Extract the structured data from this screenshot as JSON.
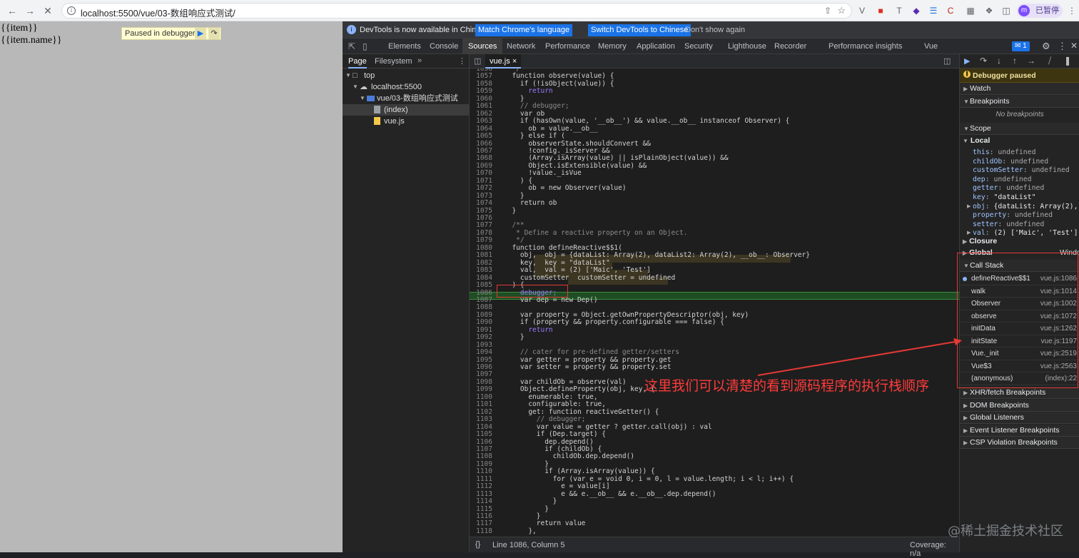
{
  "browser": {
    "url": "localhost:5500/vue/03-数组响应式测试/",
    "profile_initial": "m",
    "profile_label": "已暂停"
  },
  "page": {
    "template_lines": [
      "{{item}}",
      "{{item.name}}"
    ],
    "paused_label": "Paused in debugger"
  },
  "devtools": {
    "infobar": {
      "message": "DevTools is now available in Chinese!",
      "match_button": "Match Chrome's language",
      "switch_button": "Switch DevTools to Chinese",
      "dismiss": "Don't show again"
    },
    "tabs": [
      "Elements",
      "Console",
      "Sources",
      "Network",
      "Performance",
      "Memory",
      "Application",
      "Security",
      "Lighthouse",
      "Recorder",
      "Performance insights",
      "Vue"
    ],
    "active_tab": "Sources",
    "issues_count": "1",
    "navigator": {
      "tabs": [
        "Page",
        "Filesystem"
      ],
      "tree": [
        "top",
        "localhost:5500",
        "vue/03-数组响应式测试",
        "(index)",
        "vue.js"
      ]
    },
    "editor": {
      "file_tab": "vue.js",
      "status_left": "Line 1086, Column 5",
      "status_right": "Coverage: n/a",
      "status_braces": "{}"
    },
    "sidebar": {
      "paused": "Debugger paused",
      "watch": "Watch",
      "breakpoints": "Breakpoints",
      "no_breakpoints": "No breakpoints",
      "scope": "Scope",
      "local": "Local",
      "scope_vars": [
        {
          "k": "this",
          "v": "undefined"
        },
        {
          "k": "childOb",
          "v": "undefined"
        },
        {
          "k": "customSetter",
          "v": "undefined"
        },
        {
          "k": "dep",
          "v": "undefined"
        },
        {
          "k": "getter",
          "v": "undefined"
        },
        {
          "k": "key",
          "v": "\"dataList\""
        },
        {
          "k": "obj",
          "v": "{dataList: Array(2),"
        },
        {
          "k": "property",
          "v": "undefined"
        },
        {
          "k": "setter",
          "v": "undefined"
        },
        {
          "k": "val",
          "v": "(2) ['Maic', 'Test']"
        }
      ],
      "closure": "Closure",
      "global": "Global",
      "global_value": "Windo",
      "call_stack": "Call Stack",
      "frames": [
        {
          "fn": "defineReactive$$1",
          "loc": "vue.js:1086"
        },
        {
          "fn": "walk",
          "loc": "vue.js:1014"
        },
        {
          "fn": "Observer",
          "loc": "vue.js:1002"
        },
        {
          "fn": "observe",
          "loc": "vue.js:1072"
        },
        {
          "fn": "initData",
          "loc": "vue.js:1262"
        },
        {
          "fn": "initState",
          "loc": "vue.js:1197"
        },
        {
          "fn": "Vue._init",
          "loc": "vue.js:2519"
        },
        {
          "fn": "Vue$3",
          "loc": "vue.js:2563"
        },
        {
          "fn": "(anonymous)",
          "loc": "(index):22"
        }
      ],
      "more_sections": [
        "XHR/fetch Breakpoints",
        "DOM Breakpoints",
        "Global Listeners",
        "Event Listener Breakpoints",
        "CSP Violation Breakpoints"
      ]
    }
  },
  "code": [
    {
      "n": "1056",
      "t": "  */",
      "c": "cm"
    },
    {
      "n": "1057",
      "t": "  function observe(value) {",
      "c": ""
    },
    {
      "n": "1058",
      "t": "    if (!isObject(value)) {",
      "c": ""
    },
    {
      "n": "1059",
      "t": "      return",
      "c": "kw"
    },
    {
      "n": "1060",
      "t": "    }",
      "c": ""
    },
    {
      "n": "1061",
      "t": "    // debugger;",
      "c": "cm"
    },
    {
      "n": "1062",
      "t": "    var ob",
      "c": ""
    },
    {
      "n": "1063",
      "t": "    if (hasOwn(value, '__ob__') && value.__ob__ instanceof Observer) {",
      "c": ""
    },
    {
      "n": "1064",
      "t": "      ob = value.__ob__",
      "c": ""
    },
    {
      "n": "1065",
      "t": "    } else if (",
      "c": ""
    },
    {
      "n": "1066",
      "t": "      observerState.shouldConvert &&",
      "c": ""
    },
    {
      "n": "1067",
      "t": "      !config._isServer &&",
      "c": ""
    },
    {
      "n": "1068",
      "t": "      (Array.isArray(value) || isPlainObject(value)) &&",
      "c": ""
    },
    {
      "n": "1069",
      "t": "      Object.isExtensible(value) &&",
      "c": ""
    },
    {
      "n": "1070",
      "t": "      !value._isVue",
      "c": ""
    },
    {
      "n": "1071",
      "t": "    ) {",
      "c": ""
    },
    {
      "n": "1072",
      "t": "      ob = new Observer(value)",
      "c": ""
    },
    {
      "n": "1073",
      "t": "    }",
      "c": ""
    },
    {
      "n": "1074",
      "t": "    return ob",
      "c": ""
    },
    {
      "n": "1075",
      "t": "  }",
      "c": ""
    },
    {
      "n": "1076",
      "t": "",
      "c": ""
    },
    {
      "n": "1077",
      "t": "  /**",
      "c": "cm"
    },
    {
      "n": "1078",
      "t": "   * Define a reactive property on an Object.",
      "c": "cm"
    },
    {
      "n": "1079",
      "t": "   */",
      "c": "cm"
    },
    {
      "n": "1080",
      "t": "  function defineReactive$$1(",
      "c": ""
    },
    {
      "n": "1081",
      "t": "    obj,  obj = {dataList: Array(2), dataList2: Array(2), __ob__: Observer}",
      "c": ""
    },
    {
      "n": "1082",
      "t": "    key,  key = \"dataList\"",
      "c": ""
    },
    {
      "n": "1083",
      "t": "    val,  val = (2) ['Maic', 'Test']",
      "c": ""
    },
    {
      "n": "1084",
      "t": "    customSetter  customSetter = undefined",
      "c": ""
    },
    {
      "n": "1085",
      "t": "  ) {",
      "c": ""
    },
    {
      "n": "1086",
      "t": "    debugger;",
      "c": "kw"
    },
    {
      "n": "1087",
      "t": "    var dep = new Dep()",
      "c": ""
    },
    {
      "n": "1088",
      "t": "",
      "c": ""
    },
    {
      "n": "1089",
      "t": "    var property = Object.getOwnPropertyDescriptor(obj, key)",
      "c": ""
    },
    {
      "n": "1090",
      "t": "    if (property && property.configurable === false) {",
      "c": ""
    },
    {
      "n": "1091",
      "t": "      return",
      "c": "kw"
    },
    {
      "n": "1092",
      "t": "    }",
      "c": ""
    },
    {
      "n": "1093",
      "t": "",
      "c": ""
    },
    {
      "n": "1094",
      "t": "    // cater for pre-defined getter/setters",
      "c": "cm"
    },
    {
      "n": "1095",
      "t": "    var getter = property && property.get",
      "c": ""
    },
    {
      "n": "1096",
      "t": "    var setter = property && property.set",
      "c": ""
    },
    {
      "n": "1097",
      "t": "",
      "c": ""
    },
    {
      "n": "1098",
      "t": "    var childOb = observe(val)",
      "c": ""
    },
    {
      "n": "1099",
      "t": "    Object.defineProperty(obj, key, {",
      "c": ""
    },
    {
      "n": "1100",
      "t": "      enumerable: true,",
      "c": ""
    },
    {
      "n": "1101",
      "t": "      configurable: true,",
      "c": ""
    },
    {
      "n": "1102",
      "t": "      get: function reactiveGetter() {",
      "c": ""
    },
    {
      "n": "1103",
      "t": "        // debugger;",
      "c": "cm"
    },
    {
      "n": "1104",
      "t": "        var value = getter ? getter.call(obj) : val",
      "c": ""
    },
    {
      "n": "1105",
      "t": "        if (Dep.target) {",
      "c": ""
    },
    {
      "n": "1106",
      "t": "          dep.depend()",
      "c": ""
    },
    {
      "n": "1107",
      "t": "          if (childOb) {",
      "c": ""
    },
    {
      "n": "1108",
      "t": "            childOb.dep.depend()",
      "c": ""
    },
    {
      "n": "1109",
      "t": "          }",
      "c": ""
    },
    {
      "n": "1110",
      "t": "          if (Array.isArray(value)) {",
      "c": ""
    },
    {
      "n": "1111",
      "t": "            for (var e = void 0, i = 0, l = value.length; i < l; i++) {",
      "c": ""
    },
    {
      "n": "1112",
      "t": "              e = value[i]",
      "c": ""
    },
    {
      "n": "1113",
      "t": "              e && e.__ob__ && e.__ob__.dep.depend()",
      "c": ""
    },
    {
      "n": "1114",
      "t": "            }",
      "c": ""
    },
    {
      "n": "1115",
      "t": "          }",
      "c": ""
    },
    {
      "n": "1116",
      "t": "        }",
      "c": ""
    },
    {
      "n": "1117",
      "t": "        return value",
      "c": ""
    },
    {
      "n": "1118",
      "t": "      },",
      "c": ""
    }
  ],
  "annotation": {
    "text": "这里我们可以清楚的看到源码程序的执行栈顺序",
    "color": "#ff3b3b"
  },
  "watermark": "@稀土掘金技术社区"
}
